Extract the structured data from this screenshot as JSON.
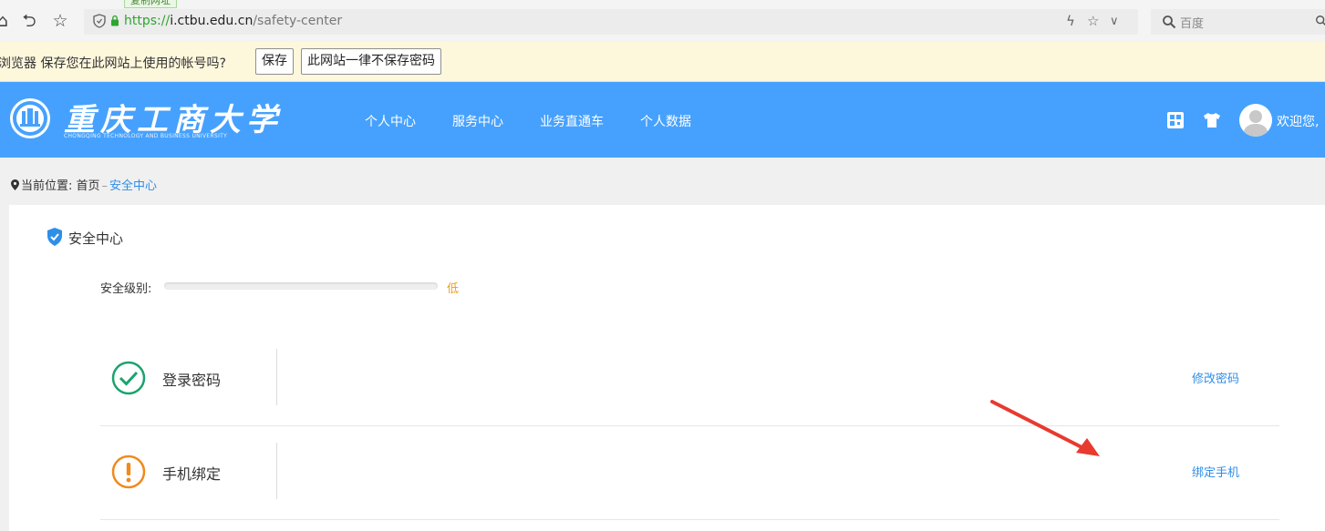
{
  "browser": {
    "copy_tip": "复制网址",
    "url_scheme": "https://",
    "url_host": "i.ctbu.edu.cn",
    "url_path": "/safety-center",
    "search_placeholder": "百度"
  },
  "password_prompt": {
    "message": "浏览器 保存您在此网站上使用的帐号吗?",
    "save_label": "保存",
    "never_label": "此网站一律不保存密码"
  },
  "header": {
    "logo_cn": "重庆工商大学",
    "logo_en": "CHONGQING TECHNOLOGY AND BUSINESS UNIVERSITY",
    "nav": [
      "个人中心",
      "服务中心",
      "业务直通车",
      "个人数据"
    ],
    "welcome": "欢迎您,"
  },
  "breadcrumb": {
    "prefix": "当前位置:",
    "home": "首页",
    "separator": "–",
    "current": "安全中心"
  },
  "card": {
    "title": "安全中心",
    "level_label": "安全级别:",
    "level_value": "低",
    "level_fraction": 0.0,
    "rows": [
      {
        "label": "登录密码",
        "action": "修改密码",
        "status": "ok",
        "icon": "check-circle-icon"
      },
      {
        "label": "手机绑定",
        "action": "绑定手机",
        "status": "warning",
        "icon": "exclamation-circle-icon"
      }
    ]
  },
  "colors": {
    "header_bg": "#46a1fe",
    "link": "#2f8ee8",
    "ok": "#1aa36d",
    "warning": "#f08a1c",
    "annotation": "#e83a2f"
  }
}
